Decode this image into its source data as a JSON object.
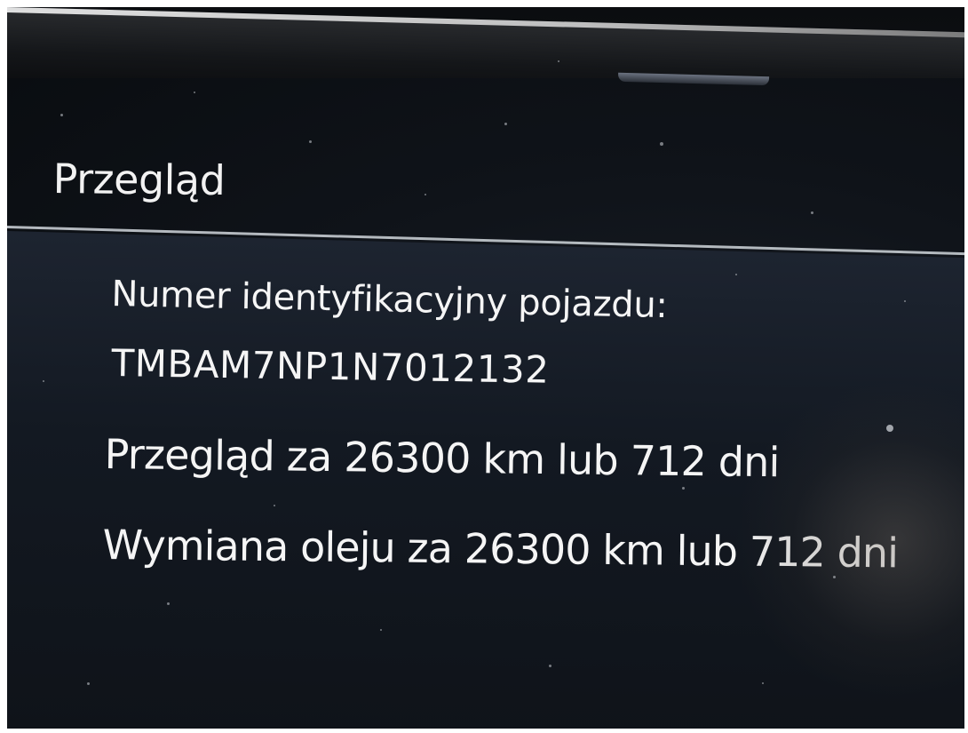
{
  "screen": {
    "title": "Przegląd",
    "vin_label": "Numer identyfikacyjny pojazdu:",
    "vin_value": "TMBAM7NP1N7012132",
    "service_text": "Przegląd za 26300 km lub 712 dni",
    "oil_text": "Wymiana oleju za 26300 km lub 712 dni"
  },
  "service": {
    "inspection_km": 26300,
    "inspection_days": 712,
    "oil_change_km": 26300,
    "oil_change_days": 712
  },
  "colors": {
    "background": "#0f1319",
    "text": "#f5f5f5",
    "divider": "#c7ccd2"
  }
}
